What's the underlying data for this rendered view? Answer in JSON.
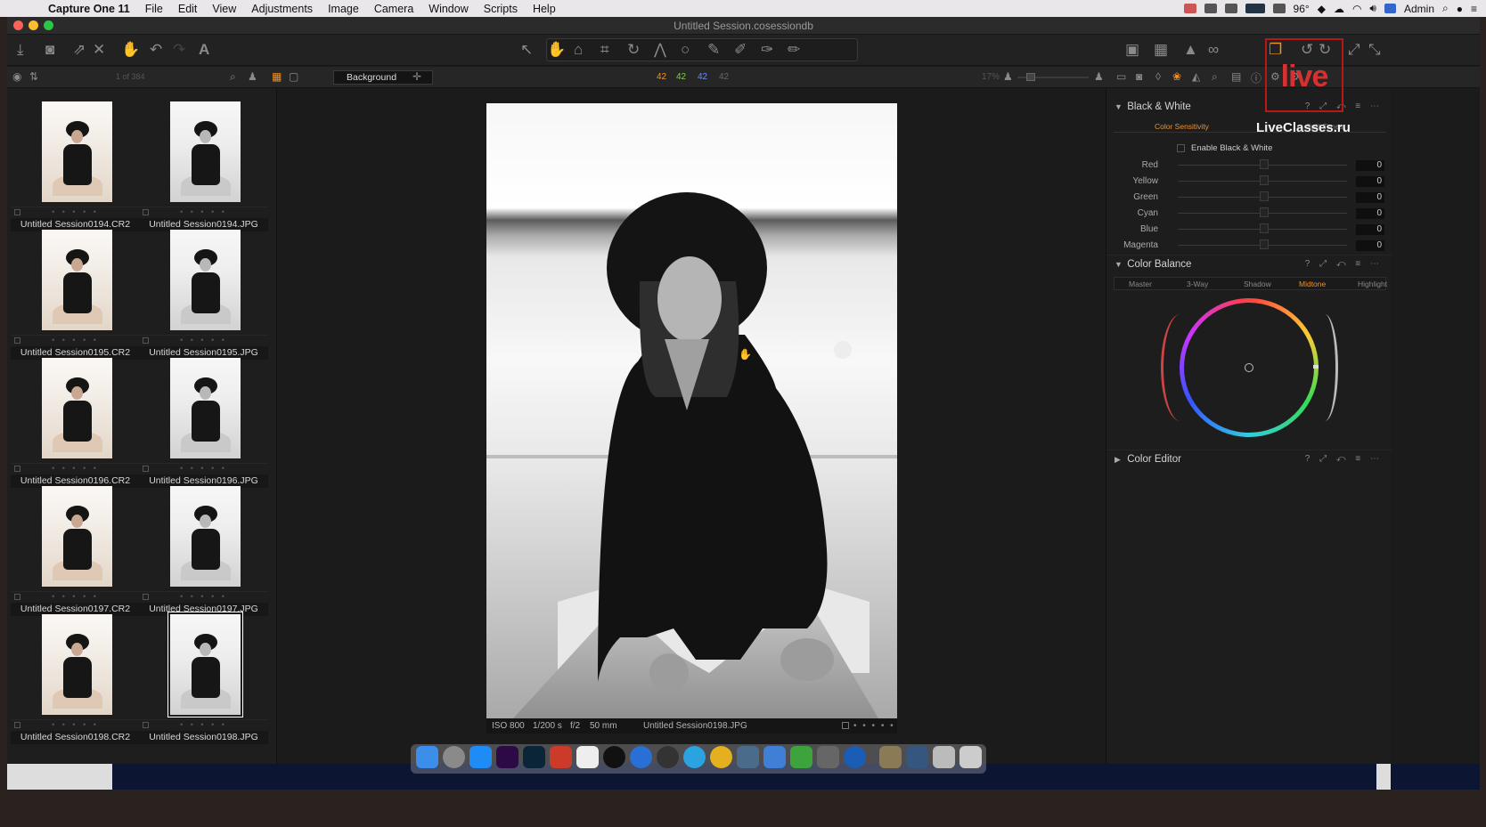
{
  "menubar": {
    "app": "Capture One 11",
    "items": [
      "File",
      "Edit",
      "View",
      "Adjustments",
      "Image",
      "Camera",
      "Window",
      "Scripts",
      "Help"
    ],
    "temp": "96°",
    "user": "Admin"
  },
  "window": {
    "title": "Untitled Session.cosessiondb"
  },
  "browser": {
    "count": "1 of 384",
    "collection": "Background",
    "numbers": [
      "42",
      "42",
      "42",
      "42"
    ],
    "zoom": "17%",
    "files": [
      {
        "name": "Untitled Session0194.CR2",
        "bw": false,
        "selected": false
      },
      {
        "name": "Untitled Session0194.JPG",
        "bw": true,
        "selected": false
      },
      {
        "name": "Untitled Session0195.CR2",
        "bw": false,
        "selected": false
      },
      {
        "name": "Untitled Session0195.JPG",
        "bw": true,
        "selected": false
      },
      {
        "name": "Untitled Session0196.CR2",
        "bw": false,
        "selected": false
      },
      {
        "name": "Untitled Session0196.JPG",
        "bw": true,
        "selected": false
      },
      {
        "name": "Untitled Session0197.CR2",
        "bw": false,
        "selected": false
      },
      {
        "name": "Untitled Session0197.JPG",
        "bw": true,
        "selected": false
      },
      {
        "name": "Untitled Session0198.CR2",
        "bw": false,
        "selected": false
      },
      {
        "name": "Untitled Session0198.JPG",
        "bw": true,
        "selected": true
      }
    ],
    "stars": "• • • • •"
  },
  "viewer": {
    "iso": "ISO 800",
    "shutter": "1/200 s",
    "aperture": "f/2",
    "focal": "50 mm",
    "filename": "Untitled Session0198.JPG",
    "stars": "• • • • •"
  },
  "tools": {
    "bw": {
      "title": "Black & White",
      "tab_sensitivity": "Color Sensitivity",
      "tab_split": "Split Tones",
      "enable_label": "Enable Black & White",
      "sliders": [
        {
          "label": "Red",
          "value": "0"
        },
        {
          "label": "Yellow",
          "value": "0"
        },
        {
          "label": "Green",
          "value": "0"
        },
        {
          "label": "Cyan",
          "value": "0"
        },
        {
          "label": "Blue",
          "value": "0"
        },
        {
          "label": "Magenta",
          "value": "0"
        }
      ]
    },
    "color_balance": {
      "title": "Color Balance",
      "tabs": [
        "Master",
        "3-Way",
        "Shadow",
        "Midtone",
        "Highlight"
      ],
      "active_tab": "Midtone"
    },
    "color_editor": {
      "title": "Color Editor"
    },
    "controls": "? ⤢ ↶ ≡ ⋯"
  },
  "watermark": {
    "logo": "live",
    "site": "LiveClasses.ru"
  },
  "colors": {
    "accent": "#f0902a",
    "highlight_green": "#7ad04a",
    "highlight_blue": "#6a8cff"
  }
}
